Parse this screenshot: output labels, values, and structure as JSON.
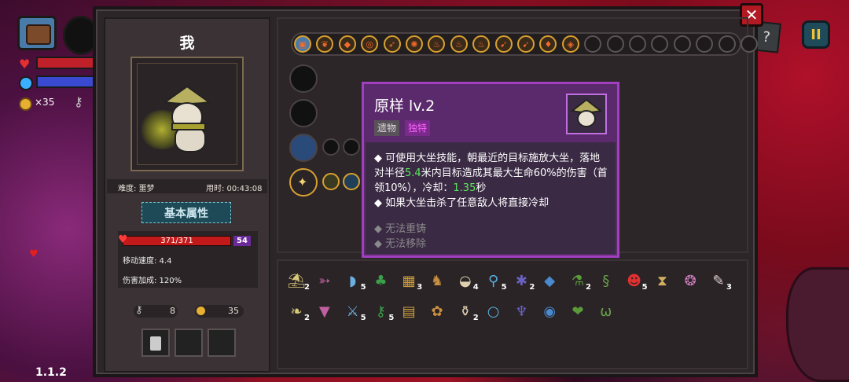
{
  "hud": {
    "coins_text": "×35",
    "version": "1.1.2"
  },
  "panel": {
    "character_name": "我",
    "difficulty": "难度: 噩梦",
    "time": "用时: 00:43:08",
    "attributes_button": "基本属性",
    "hp_text": "371/371",
    "shield_value": "54",
    "move_speed": "移动速度: 4.4",
    "damage_bonus": "伤害加成: 120%",
    "keys": "8",
    "coins": "35"
  },
  "tooltip": {
    "title": "原样 lv.2",
    "tag_relic": "遗物",
    "tag_unique": "独特",
    "line1_a": "◆ 可使用大坐技能，朝最近的目标施放大坐，落地对半径",
    "line1_radius": "5.4",
    "line1_b": "米内目标造成其最大生命60%的伤害（首领10%），冷却：",
    "line1_cd": "1.35",
    "line1_c": "秒",
    "line2": "◆ 如果大坐击杀了任意敌人将直接冷却",
    "meta1": "◆ 无法重铸",
    "meta2": "◆ 无法移除"
  },
  "relic_bar": {
    "filled": [
      "chest-icon",
      "wheat-icon",
      "seed-icon",
      "target-icon",
      "fire-arrow-icon",
      "burst-icon",
      "flame-icon",
      "flame-icon",
      "flame-icon",
      "flame-arrow-icon",
      "flame-arrow-icon",
      "flame-shield-icon",
      "flame-gem-icon"
    ],
    "empty_count": 8
  },
  "inventory": {
    "row1": [
      {
        "icon": "straw-hat-icon",
        "count": "2"
      },
      {
        "icon": "feather-icon",
        "count": ""
      },
      {
        "icon": "fish-icon",
        "count": "5"
      },
      {
        "icon": "clover-icon",
        "count": ""
      },
      {
        "icon": "scroll-icon",
        "count": "3"
      },
      {
        "icon": "cat-icon",
        "count": ""
      },
      {
        "icon": "bread-icon",
        "count": "4"
      },
      {
        "icon": "magnifier-icon",
        "count": "5"
      },
      {
        "icon": "bug-icon",
        "count": "2"
      },
      {
        "icon": "crystal-icon",
        "count": ""
      },
      {
        "icon": "potion-icon",
        "count": "2"
      },
      {
        "icon": "snake-icon",
        "count": ""
      },
      {
        "icon": "demon-mask-icon",
        "count": "5"
      },
      {
        "icon": "hourglass-icon",
        "count": ""
      },
      {
        "icon": "brain-icon",
        "count": ""
      },
      {
        "icon": "quill-icon",
        "count": "3"
      }
    ],
    "row2": [
      {
        "icon": "leaf-wing-icon",
        "count": "2"
      },
      {
        "icon": "banner-icon",
        "count": ""
      },
      {
        "icon": "sword-icon",
        "count": "5"
      },
      {
        "icon": "key-icon",
        "count": "5"
      },
      {
        "icon": "map-icon",
        "count": ""
      },
      {
        "icon": "sprout-icon",
        "count": ""
      },
      {
        "icon": "vial-icon",
        "count": "2"
      },
      {
        "icon": "ring-icon",
        "count": ""
      },
      {
        "icon": "horn-helm-icon",
        "count": ""
      },
      {
        "icon": "orb-icon",
        "count": ""
      },
      {
        "icon": "heart-creature-icon",
        "count": ""
      },
      {
        "icon": "teeth-icon",
        "count": ""
      }
    ]
  }
}
